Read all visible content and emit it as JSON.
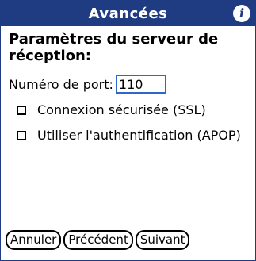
{
  "header": {
    "title": "Avancées",
    "info_icon": "info-icon",
    "info_glyph": "i"
  },
  "form": {
    "heading": "Paramètres du serveur de réception:",
    "port_label": "Numéro de port:",
    "port_value": "110",
    "options": [
      {
        "label": "Connexion sécurisée (SSL)",
        "checked": false
      },
      {
        "label": "Utiliser l'authentification (APOP)",
        "checked": false
      }
    ]
  },
  "buttons": {
    "cancel": "Annuler",
    "previous": "Précédent",
    "next": "Suivant"
  },
  "colors": {
    "titlebar": "#1f3b82",
    "input_border": "#2f66c9"
  }
}
